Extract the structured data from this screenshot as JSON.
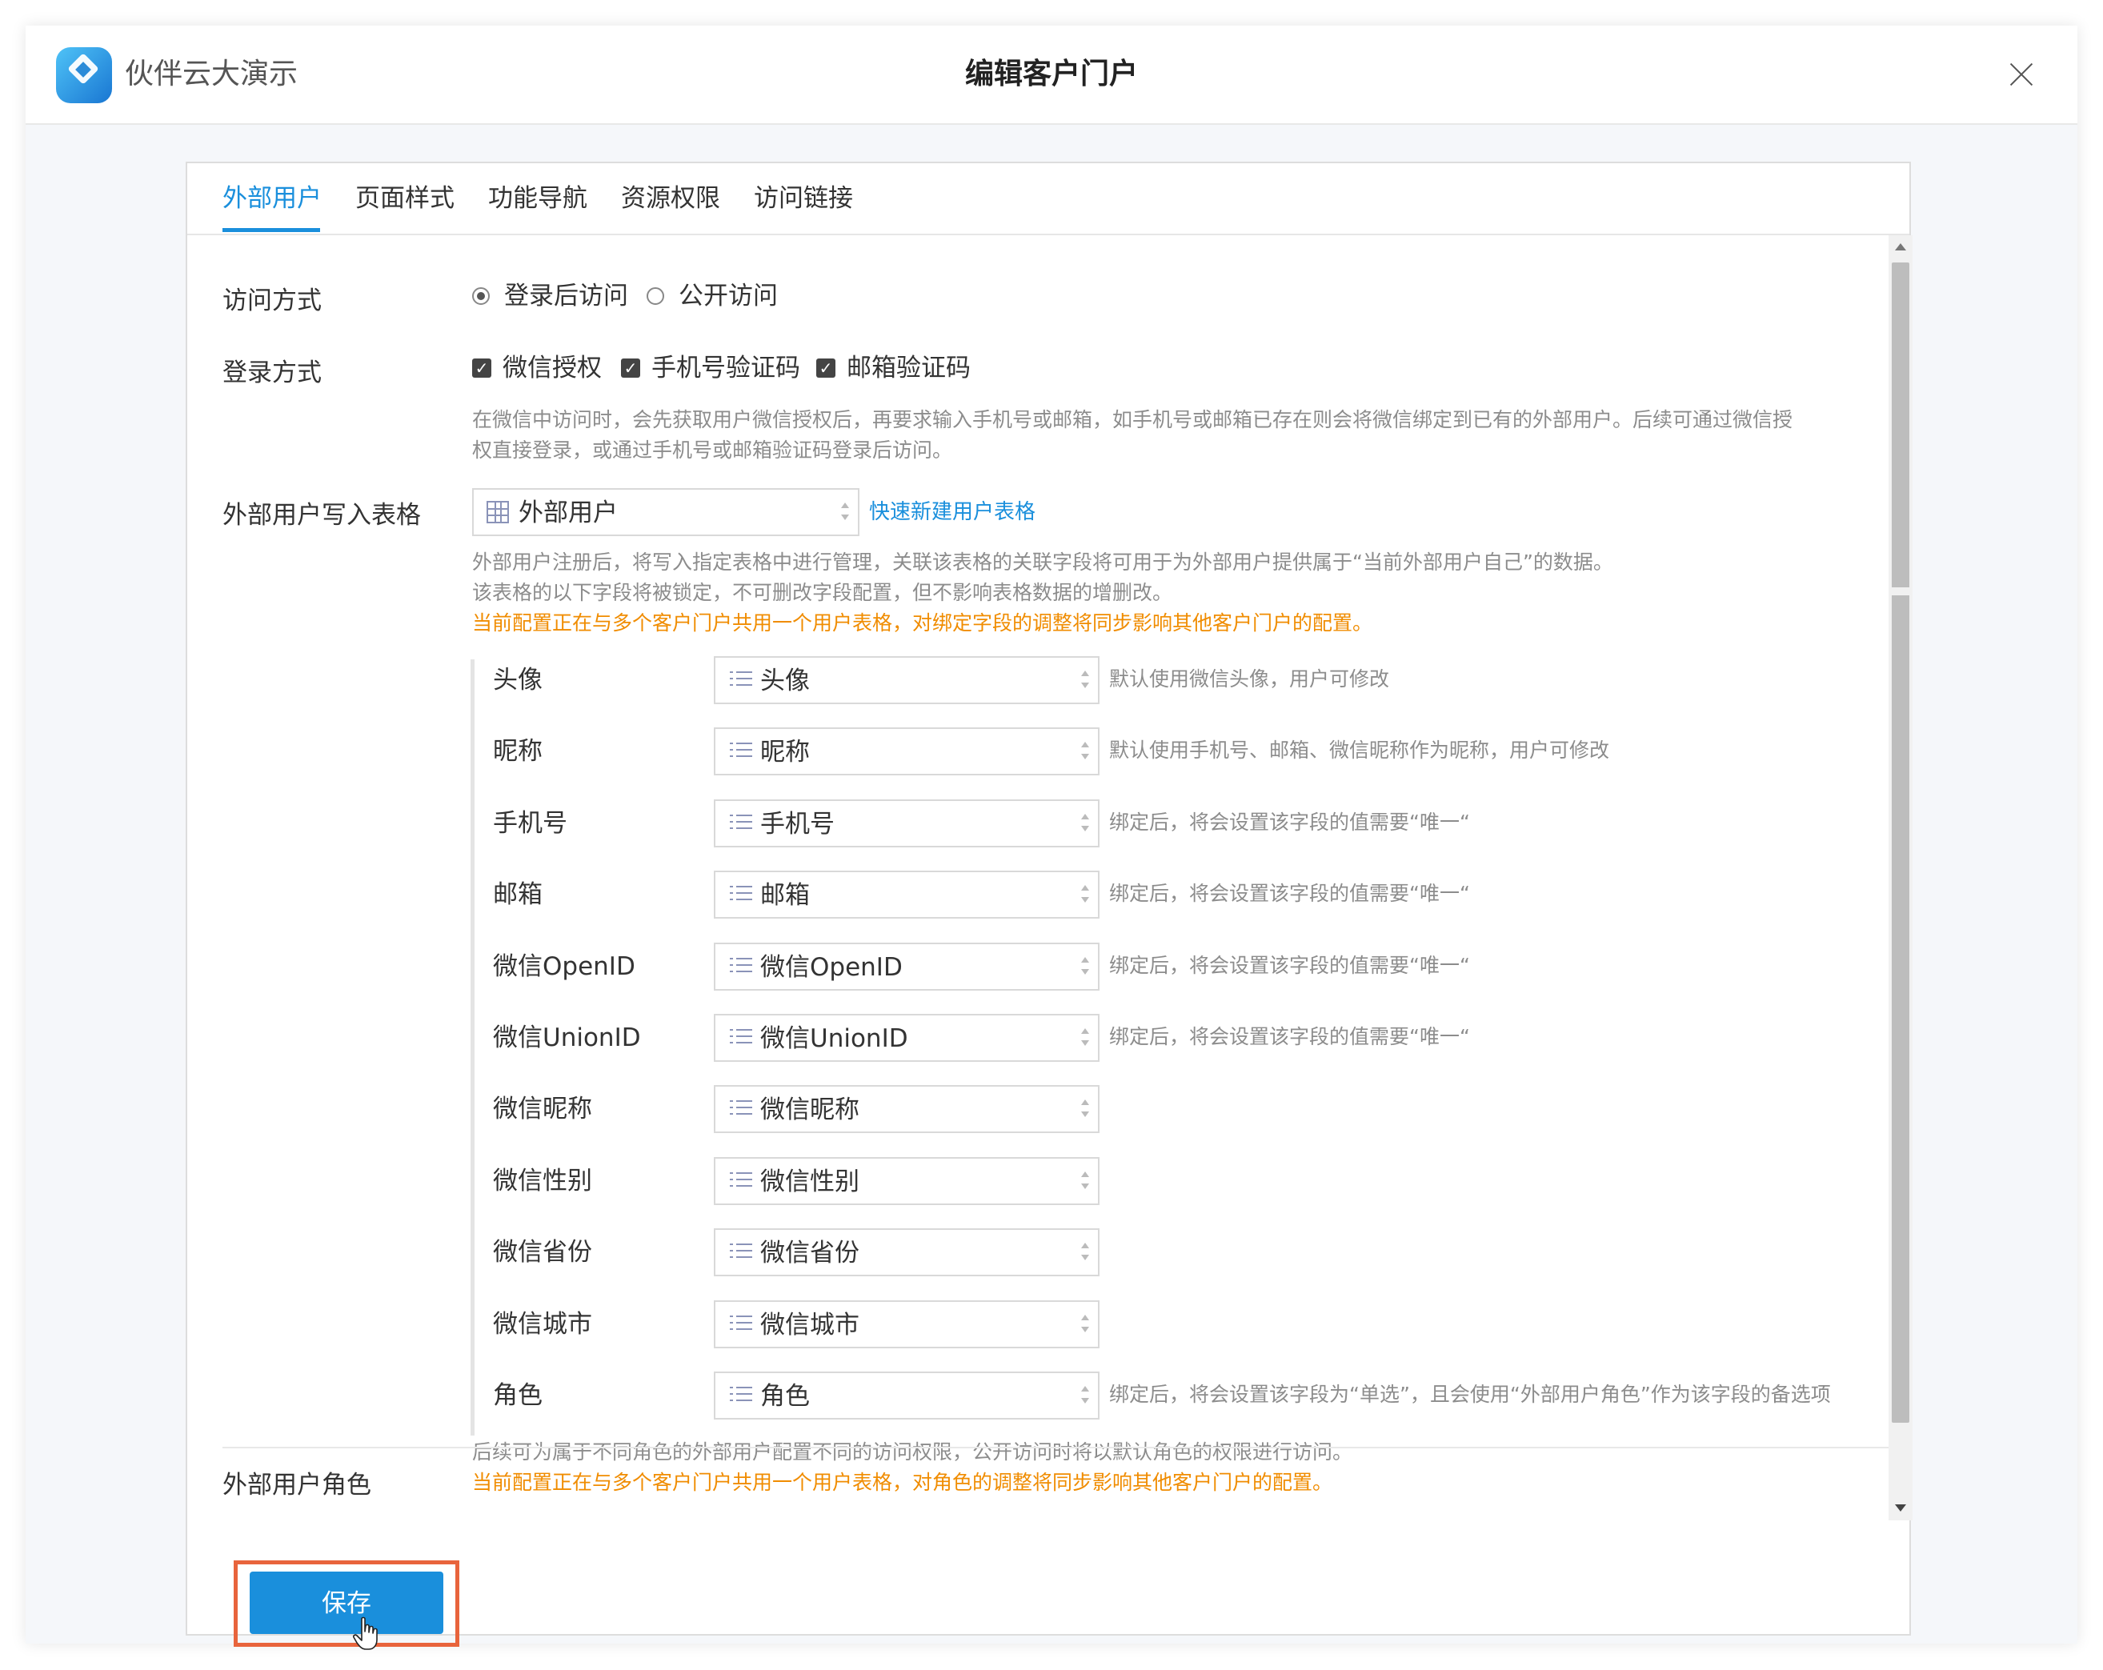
{
  "app": {
    "name": "伙伴云大演示",
    "logo_small_text": "伙伴云大演示"
  },
  "dialog": {
    "title": "编辑客户门户"
  },
  "tabs": [
    {
      "label": "外部用户",
      "active": true
    },
    {
      "label": "页面样式",
      "active": false
    },
    {
      "label": "功能导航",
      "active": false
    },
    {
      "label": "资源权限",
      "active": false
    },
    {
      "label": "访问链接",
      "active": false
    }
  ],
  "access": {
    "label": "访问方式",
    "options": [
      {
        "label": "登录后访问",
        "selected": true
      },
      {
        "label": "公开访问",
        "selected": false
      }
    ]
  },
  "login": {
    "label": "登录方式",
    "options": [
      {
        "label": "微信授权",
        "checked": true
      },
      {
        "label": "手机号验证码",
        "checked": true
      },
      {
        "label": "邮箱验证码",
        "checked": true
      }
    ],
    "hint_line1": "在微信中访问时，会先获取用户微信授权后，再要求输入手机号或邮箱，如手机号或邮箱已存在则会将微信绑定到已有的外部用户。后续可通过微信授",
    "hint_line2": "权直接登录，或通过手机号或邮箱验证码登录后访问。"
  },
  "table": {
    "label": "外部用户写入表格",
    "value": "外部用户",
    "create_link": "快速新建用户表格",
    "hint_line1": "外部用户注册后，将写入指定表格中进行管理，关联该表格的关联字段将可用于为外部用户提供属于“当前外部用户自己”的数据。",
    "hint_line2": "该表格的以下字段将被锁定，不可删改字段配置，但不影响表格数据的增删改。",
    "warning": "当前配置正在与多个客户门户共用一个用户表格，对绑定字段的调整将同步影响其他客户门户的配置。"
  },
  "fields": [
    {
      "label": "头像",
      "value": "头像",
      "hint": "默认使用微信头像，用户可修改"
    },
    {
      "label": "昵称",
      "value": "昵称",
      "hint": "默认使用手机号、邮箱、微信昵称作为昵称，用户可修改"
    },
    {
      "label": "手机号",
      "value": "手机号",
      "hint": "绑定后，将会设置该字段的值需要“唯一“"
    },
    {
      "label": "邮箱",
      "value": "邮箱",
      "hint": "绑定后，将会设置该字段的值需要“唯一“"
    },
    {
      "label": "微信OpenID",
      "value": "微信OpenID",
      "hint": "绑定后，将会设置该字段的值需要“唯一“"
    },
    {
      "label": "微信UnionID",
      "value": "微信UnionID",
      "hint": "绑定后，将会设置该字段的值需要“唯一“"
    },
    {
      "label": "微信昵称",
      "value": "微信昵称",
      "hint": ""
    },
    {
      "label": "微信性别",
      "value": "微信性别",
      "hint": ""
    },
    {
      "label": "微信省份",
      "value": "微信省份",
      "hint": ""
    },
    {
      "label": "微信城市",
      "value": "微信城市",
      "hint": ""
    },
    {
      "label": "角色",
      "value": "角色",
      "hint": "绑定后，将会设置该字段为“单选”，且会使用“外部用户角色”作为该字段的备选项"
    }
  ],
  "roles": {
    "label": "外部用户角色",
    "hint": "后续可为属于不同角色的外部用户配置不同的访问权限，公开访问时将以默认角色的权限进行访问。",
    "warning": "当前配置正在与多个客户门户共用一个用户表格，对角色的调整将同步影响其他客户门户的配置。"
  },
  "footer": {
    "save_label": "保存"
  },
  "colors": {
    "accent": "#1a8fdc",
    "warning": "#f08c00",
    "highlight": "#e8643c"
  }
}
